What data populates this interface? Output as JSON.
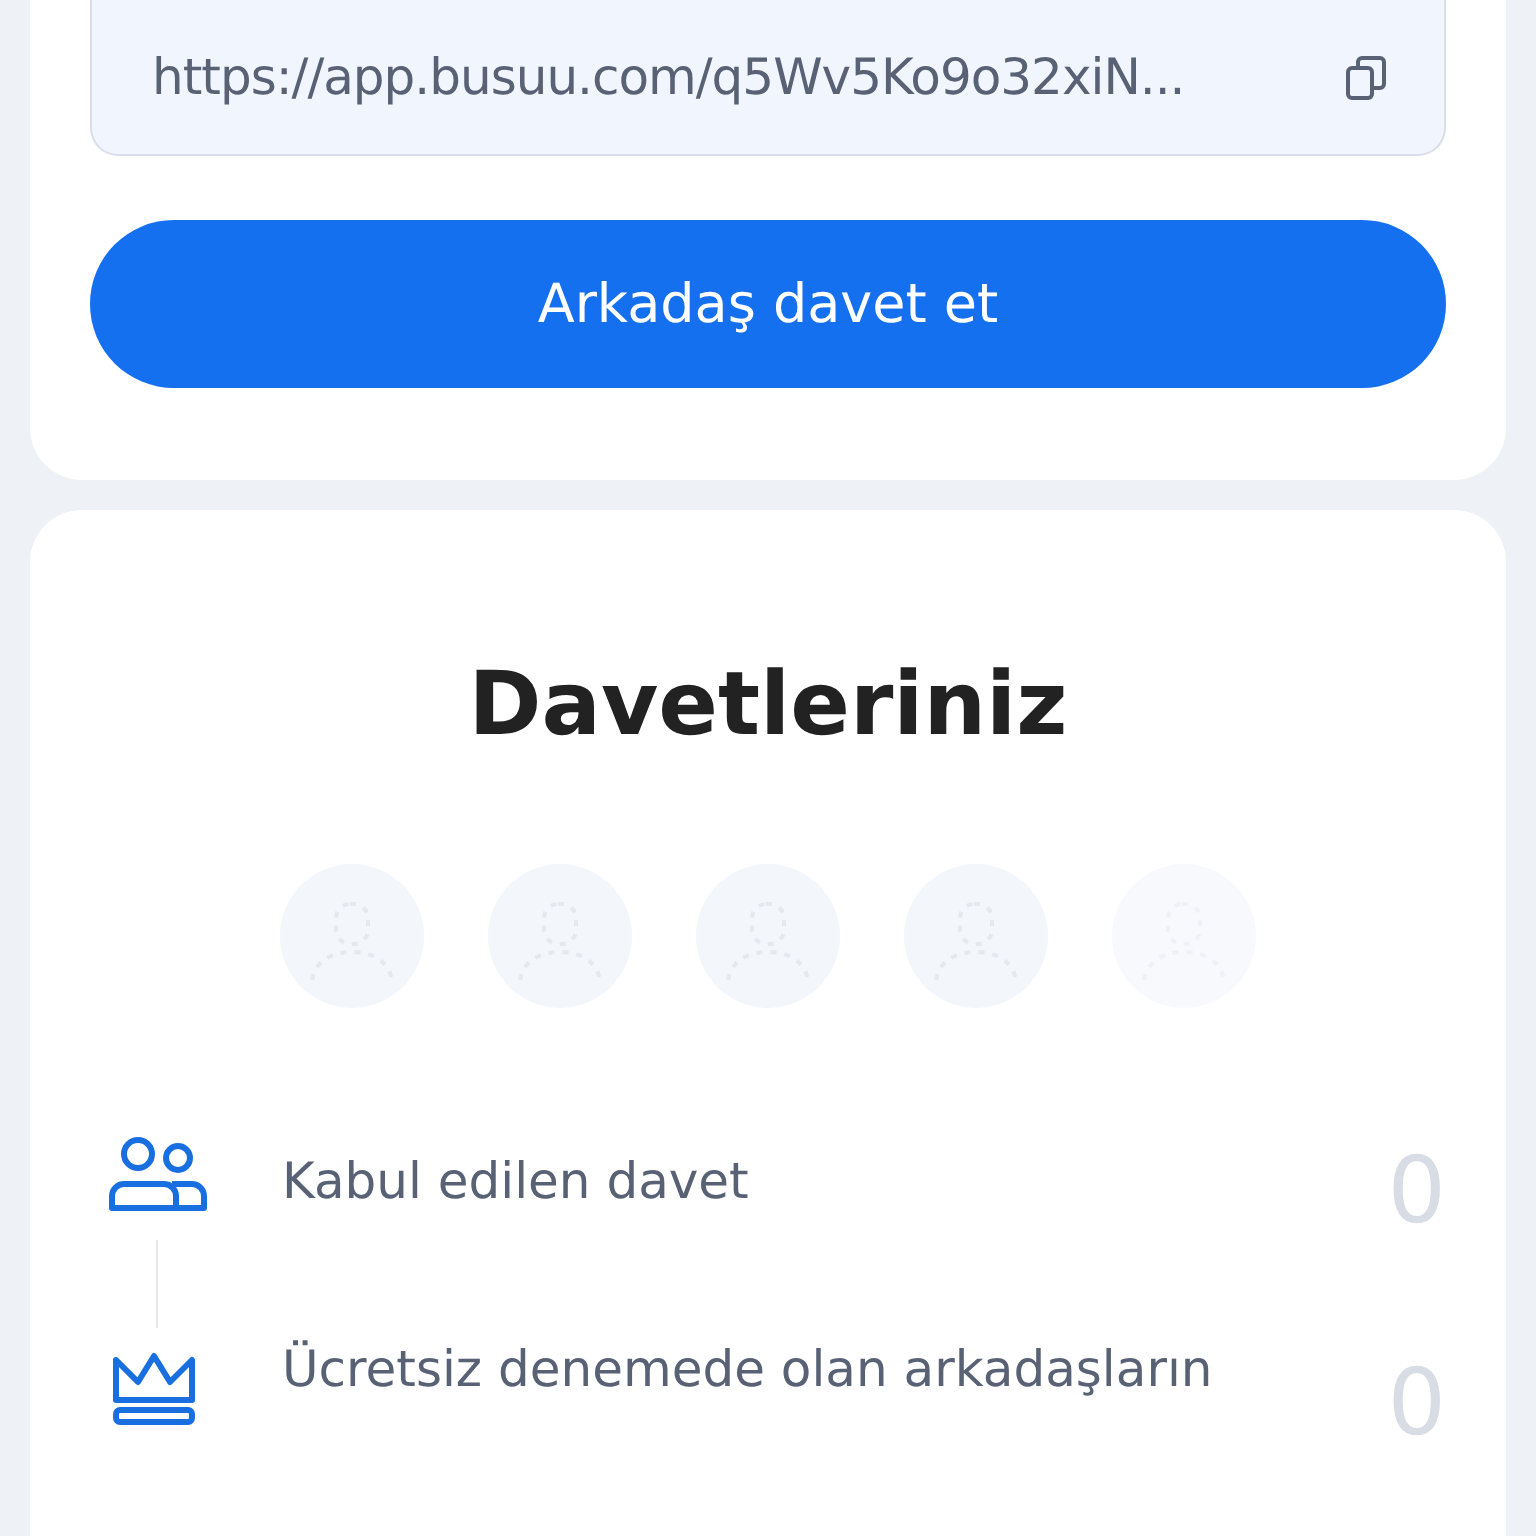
{
  "invite_link": {
    "url": "https://app.busuu.com/q5Wv5Ko9o32xiN..."
  },
  "invite_button": {
    "label": "Arkadaş davet et"
  },
  "invitations": {
    "title": "Davetleriniz",
    "avatars": [
      {
        "kind": "placeholder"
      },
      {
        "kind": "placeholder"
      },
      {
        "kind": "placeholder"
      },
      {
        "kind": "placeholder"
      },
      {
        "kind": "placeholder"
      }
    ],
    "stats": [
      {
        "kind": "people",
        "label": "Kabul edilen davet",
        "count": "0"
      },
      {
        "kind": "crown",
        "label": "Ücretsiz denemede olan arkadaşların",
        "count": "0"
      }
    ]
  }
}
